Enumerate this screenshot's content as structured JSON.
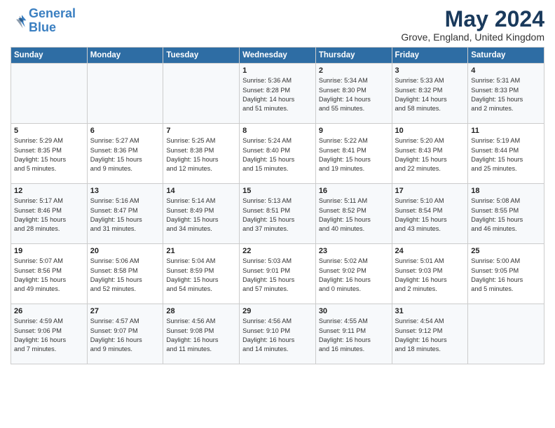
{
  "header": {
    "logo_line1": "General",
    "logo_line2": "Blue",
    "title": "May 2024",
    "subtitle": "Grove, England, United Kingdom"
  },
  "days_of_week": [
    "Sunday",
    "Monday",
    "Tuesday",
    "Wednesday",
    "Thursday",
    "Friday",
    "Saturday"
  ],
  "weeks": [
    [
      {
        "day": "",
        "info": ""
      },
      {
        "day": "",
        "info": ""
      },
      {
        "day": "",
        "info": ""
      },
      {
        "day": "1",
        "info": "Sunrise: 5:36 AM\nSunset: 8:28 PM\nDaylight: 14 hours\nand 51 minutes."
      },
      {
        "day": "2",
        "info": "Sunrise: 5:34 AM\nSunset: 8:30 PM\nDaylight: 14 hours\nand 55 minutes."
      },
      {
        "day": "3",
        "info": "Sunrise: 5:33 AM\nSunset: 8:32 PM\nDaylight: 14 hours\nand 58 minutes."
      },
      {
        "day": "4",
        "info": "Sunrise: 5:31 AM\nSunset: 8:33 PM\nDaylight: 15 hours\nand 2 minutes."
      }
    ],
    [
      {
        "day": "5",
        "info": "Sunrise: 5:29 AM\nSunset: 8:35 PM\nDaylight: 15 hours\nand 5 minutes."
      },
      {
        "day": "6",
        "info": "Sunrise: 5:27 AM\nSunset: 8:36 PM\nDaylight: 15 hours\nand 9 minutes."
      },
      {
        "day": "7",
        "info": "Sunrise: 5:25 AM\nSunset: 8:38 PM\nDaylight: 15 hours\nand 12 minutes."
      },
      {
        "day": "8",
        "info": "Sunrise: 5:24 AM\nSunset: 8:40 PM\nDaylight: 15 hours\nand 15 minutes."
      },
      {
        "day": "9",
        "info": "Sunrise: 5:22 AM\nSunset: 8:41 PM\nDaylight: 15 hours\nand 19 minutes."
      },
      {
        "day": "10",
        "info": "Sunrise: 5:20 AM\nSunset: 8:43 PM\nDaylight: 15 hours\nand 22 minutes."
      },
      {
        "day": "11",
        "info": "Sunrise: 5:19 AM\nSunset: 8:44 PM\nDaylight: 15 hours\nand 25 minutes."
      }
    ],
    [
      {
        "day": "12",
        "info": "Sunrise: 5:17 AM\nSunset: 8:46 PM\nDaylight: 15 hours\nand 28 minutes."
      },
      {
        "day": "13",
        "info": "Sunrise: 5:16 AM\nSunset: 8:47 PM\nDaylight: 15 hours\nand 31 minutes."
      },
      {
        "day": "14",
        "info": "Sunrise: 5:14 AM\nSunset: 8:49 PM\nDaylight: 15 hours\nand 34 minutes."
      },
      {
        "day": "15",
        "info": "Sunrise: 5:13 AM\nSunset: 8:51 PM\nDaylight: 15 hours\nand 37 minutes."
      },
      {
        "day": "16",
        "info": "Sunrise: 5:11 AM\nSunset: 8:52 PM\nDaylight: 15 hours\nand 40 minutes."
      },
      {
        "day": "17",
        "info": "Sunrise: 5:10 AM\nSunset: 8:54 PM\nDaylight: 15 hours\nand 43 minutes."
      },
      {
        "day": "18",
        "info": "Sunrise: 5:08 AM\nSunset: 8:55 PM\nDaylight: 15 hours\nand 46 minutes."
      }
    ],
    [
      {
        "day": "19",
        "info": "Sunrise: 5:07 AM\nSunset: 8:56 PM\nDaylight: 15 hours\nand 49 minutes."
      },
      {
        "day": "20",
        "info": "Sunrise: 5:06 AM\nSunset: 8:58 PM\nDaylight: 15 hours\nand 52 minutes."
      },
      {
        "day": "21",
        "info": "Sunrise: 5:04 AM\nSunset: 8:59 PM\nDaylight: 15 hours\nand 54 minutes."
      },
      {
        "day": "22",
        "info": "Sunrise: 5:03 AM\nSunset: 9:01 PM\nDaylight: 15 hours\nand 57 minutes."
      },
      {
        "day": "23",
        "info": "Sunrise: 5:02 AM\nSunset: 9:02 PM\nDaylight: 16 hours\nand 0 minutes."
      },
      {
        "day": "24",
        "info": "Sunrise: 5:01 AM\nSunset: 9:03 PM\nDaylight: 16 hours\nand 2 minutes."
      },
      {
        "day": "25",
        "info": "Sunrise: 5:00 AM\nSunset: 9:05 PM\nDaylight: 16 hours\nand 5 minutes."
      }
    ],
    [
      {
        "day": "26",
        "info": "Sunrise: 4:59 AM\nSunset: 9:06 PM\nDaylight: 16 hours\nand 7 minutes."
      },
      {
        "day": "27",
        "info": "Sunrise: 4:57 AM\nSunset: 9:07 PM\nDaylight: 16 hours\nand 9 minutes."
      },
      {
        "day": "28",
        "info": "Sunrise: 4:56 AM\nSunset: 9:08 PM\nDaylight: 16 hours\nand 11 minutes."
      },
      {
        "day": "29",
        "info": "Sunrise: 4:56 AM\nSunset: 9:10 PM\nDaylight: 16 hours\nand 14 minutes."
      },
      {
        "day": "30",
        "info": "Sunrise: 4:55 AM\nSunset: 9:11 PM\nDaylight: 16 hours\nand 16 minutes."
      },
      {
        "day": "31",
        "info": "Sunrise: 4:54 AM\nSunset: 9:12 PM\nDaylight: 16 hours\nand 18 minutes."
      },
      {
        "day": "",
        "info": ""
      }
    ]
  ]
}
